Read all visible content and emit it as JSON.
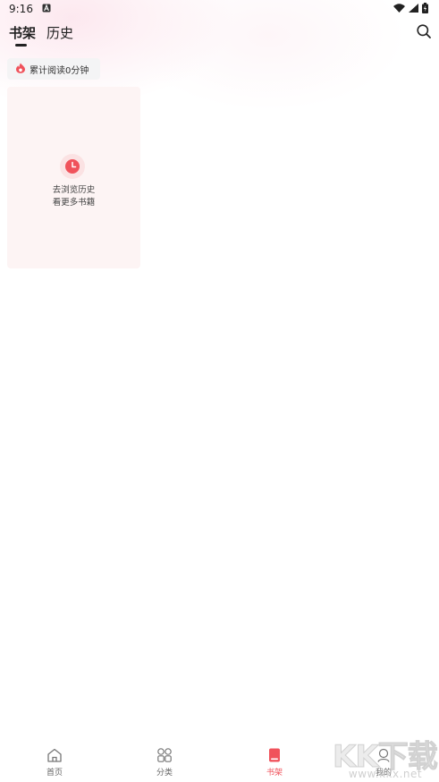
{
  "status_bar": {
    "time": "9:16",
    "notification_icon": "font-a-icon",
    "wifi_icon": "wifi-icon",
    "signal_icon": "signal-icon",
    "battery_icon": "battery-icon"
  },
  "header": {
    "tabs": [
      {
        "label": "书架",
        "active": true
      },
      {
        "label": "历史",
        "active": false
      }
    ],
    "search_icon": "search-icon"
  },
  "reading_stat": {
    "icon": "flame-icon",
    "text": "累计阅读0分钟"
  },
  "empty_card": {
    "icon": "clock-icon",
    "line1": "去浏览历史",
    "line2": "看更多书籍"
  },
  "bottom_nav": {
    "items": [
      {
        "label": "首页",
        "icon": "home-icon",
        "active": false
      },
      {
        "label": "分类",
        "icon": "category-grid-icon",
        "active": false
      },
      {
        "label": "书架",
        "icon": "bookshelf-icon",
        "active": true
      },
      {
        "label": "我的",
        "icon": "profile-icon",
        "active": false
      }
    ]
  },
  "watermark": {
    "brand": "KK下载",
    "url": "www.kkx.net"
  },
  "colors": {
    "accent": "#f0525b",
    "card_background": "#fdf4f4",
    "chip_background": "#f4f4f5",
    "text_primary": "#222222"
  }
}
